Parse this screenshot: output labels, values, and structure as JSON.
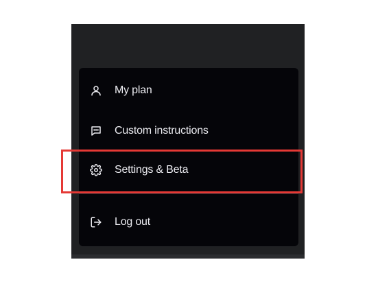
{
  "menu": {
    "items": [
      {
        "label": "My plan",
        "icon": "user-icon"
      },
      {
        "label": "Custom instructions",
        "icon": "chat-message-icon"
      },
      {
        "label": "Settings & Beta",
        "icon": "gear-icon"
      },
      {
        "label": "Log out",
        "icon": "log-out-icon"
      }
    ]
  },
  "highlight": {
    "color": "#e53935",
    "target": "Settings & Beta"
  },
  "colors": {
    "panel_background": "#202123",
    "menu_background": "#050509",
    "text": "#ececf1",
    "page_background": "#ffffff"
  }
}
